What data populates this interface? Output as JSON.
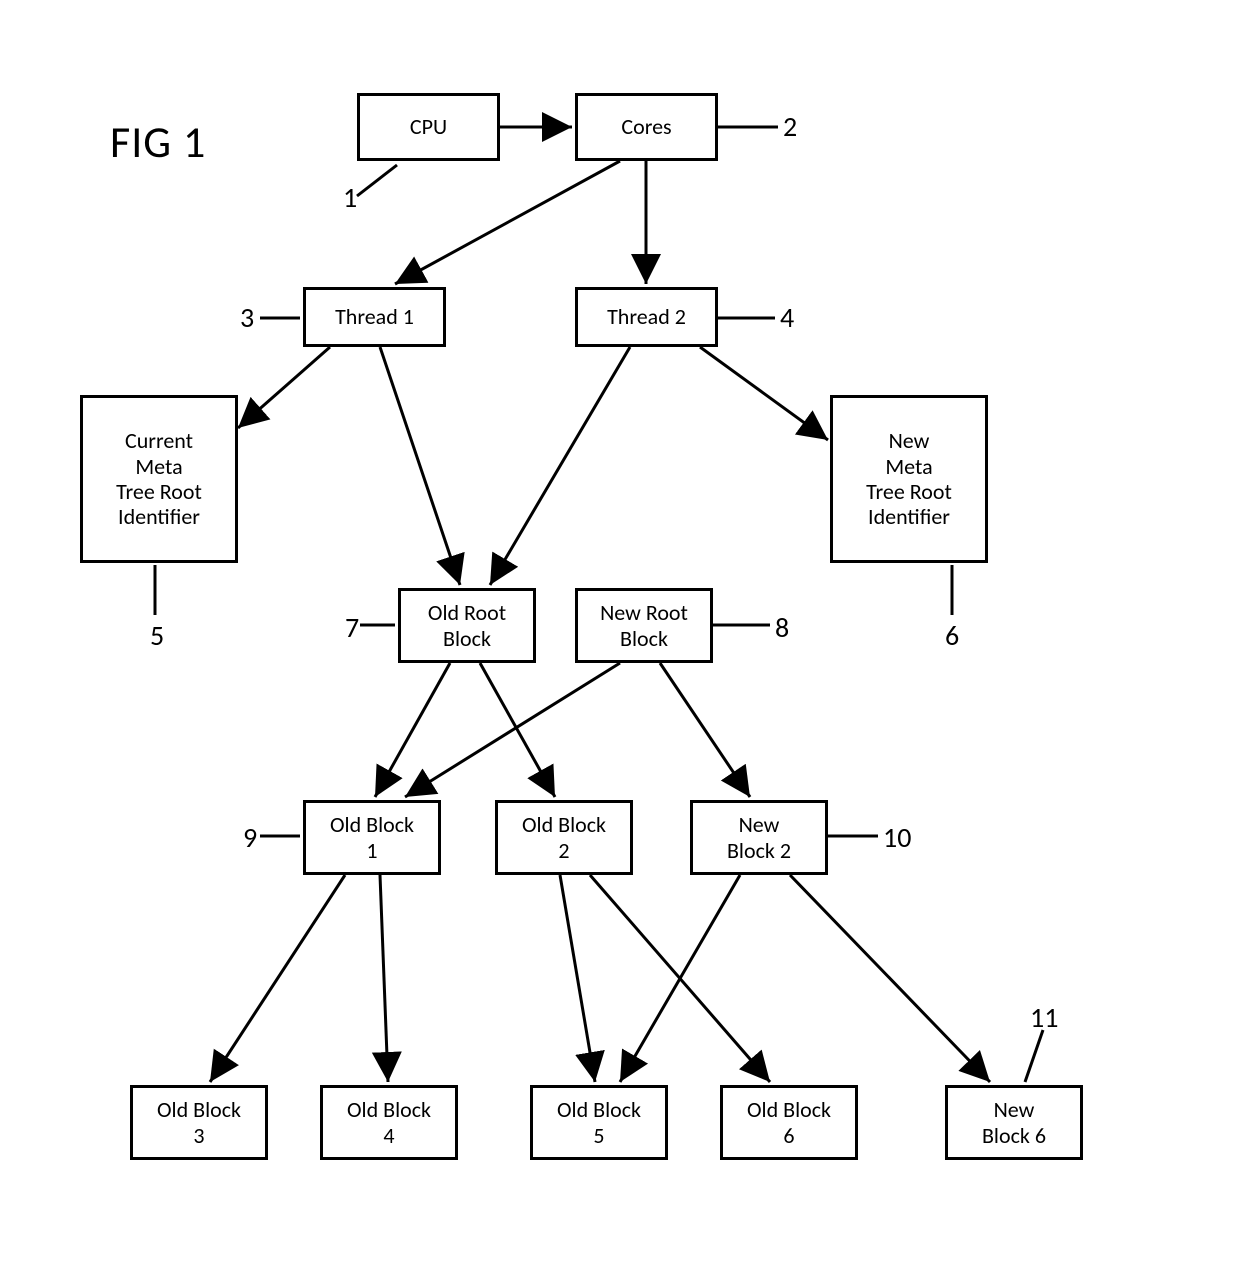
{
  "figure_title": "FIG 1",
  "nodes": {
    "cpu": {
      "label": "CPU",
      "ref": "1"
    },
    "cores": {
      "label": "Cores",
      "ref": "2"
    },
    "thread1": {
      "label": "Thread 1",
      "ref": "3"
    },
    "thread2": {
      "label": "Thread 2",
      "ref": "4"
    },
    "cur_meta": {
      "label": "Current\nMeta\nTree Root\nIdentifier",
      "ref": "5"
    },
    "new_meta": {
      "label": "New\nMeta\nTree Root\nIdentifier",
      "ref": "6"
    },
    "old_root": {
      "label": "Old Root\nBlock",
      "ref": "7"
    },
    "new_root": {
      "label": "New Root\nBlock",
      "ref": "8"
    },
    "old_b1": {
      "label": "Old Block\n1",
      "ref": "9"
    },
    "old_b2": {
      "label": "Old Block\n2",
      "ref": ""
    },
    "new_b2": {
      "label": "New\nBlock 2",
      "ref": "10"
    },
    "old_b3": {
      "label": "Old Block\n3",
      "ref": ""
    },
    "old_b4": {
      "label": "Old Block\n4",
      "ref": ""
    },
    "old_b5": {
      "label": "Old Block\n5",
      "ref": ""
    },
    "old_b6": {
      "label": "Old Block\n6",
      "ref": ""
    },
    "new_b6": {
      "label": "New\nBlock 6",
      "ref": "11"
    }
  },
  "edges": [
    [
      "cpu",
      "cores"
    ],
    [
      "cores",
      "thread1"
    ],
    [
      "cores",
      "thread2"
    ],
    [
      "thread1",
      "cur_meta"
    ],
    [
      "thread1",
      "old_root"
    ],
    [
      "thread2",
      "new_meta"
    ],
    [
      "thread2",
      "old_root"
    ],
    [
      "old_root",
      "old_b1"
    ],
    [
      "old_root",
      "old_b2"
    ],
    [
      "new_root",
      "old_b1"
    ],
    [
      "new_root",
      "new_b2"
    ],
    [
      "old_b1",
      "old_b3"
    ],
    [
      "old_b1",
      "old_b4"
    ],
    [
      "old_b2",
      "old_b5"
    ],
    [
      "old_b2",
      "old_b6"
    ],
    [
      "new_b2",
      "old_b5"
    ],
    [
      "new_b2",
      "new_b6"
    ]
  ]
}
